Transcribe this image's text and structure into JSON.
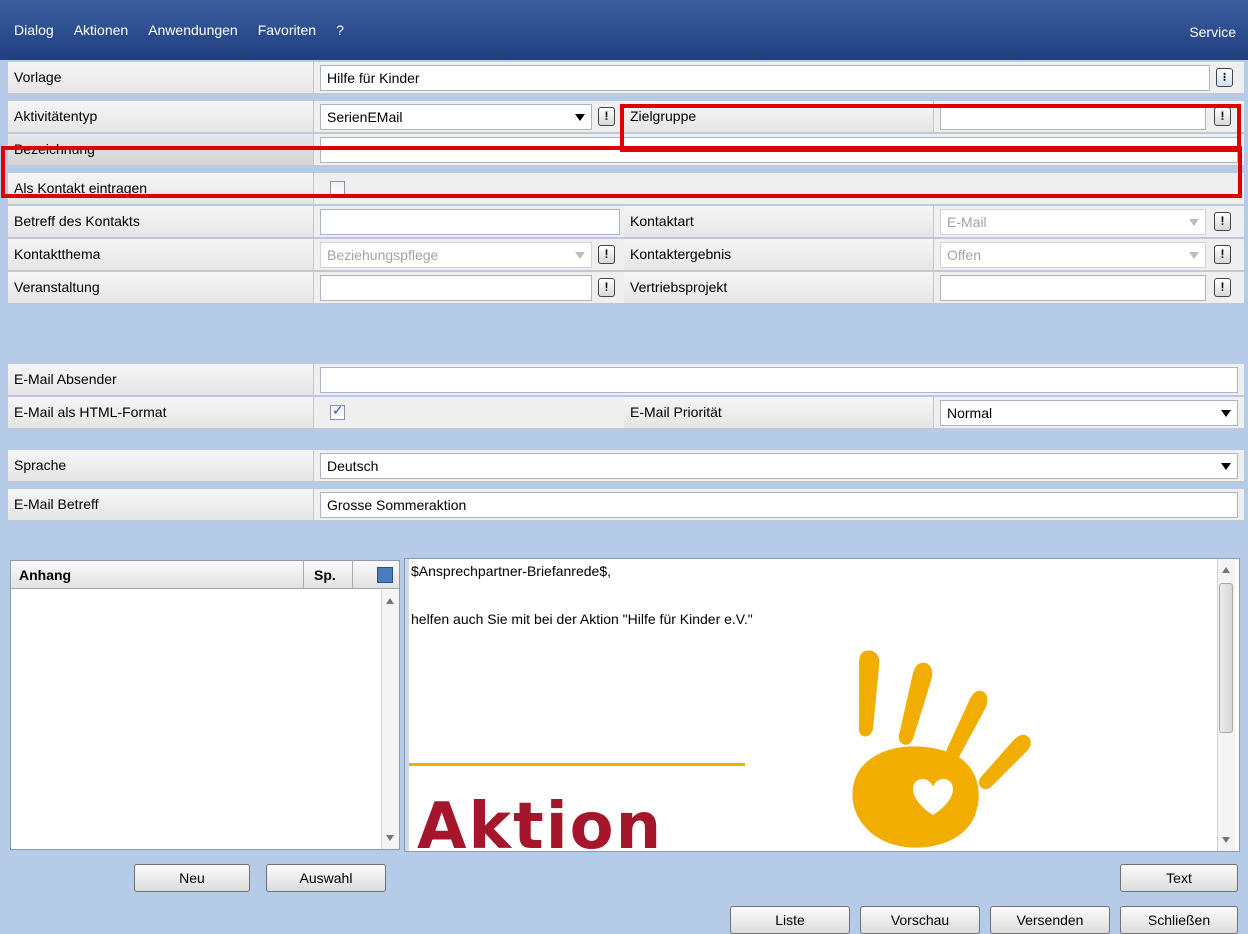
{
  "menu": {
    "items": [
      "Dialog",
      "Aktionen",
      "Anwendungen",
      "Favoriten",
      "?"
    ],
    "service": "Service"
  },
  "form": {
    "vorlage_label": "Vorlage",
    "vorlage_value": "Hilfe für Kinder",
    "aktivitaetentyp_label": "Aktivitätentyp",
    "aktivitaetentyp_value": "SerienEMail",
    "zielgruppe_label": "Zielgruppe",
    "zielgruppe_value": "",
    "bezeichnung_label": "Bezeichnung",
    "bezeichnung_value": "",
    "als_kontakt_label": "Als Kontakt eintragen",
    "als_kontakt_checked": false,
    "betreff_kontakt_label": "Betreff des Kontakts",
    "betreff_kontakt_value": "",
    "kontaktart_label": "Kontaktart",
    "kontaktart_value": "E-Mail",
    "kontaktthema_label": "Kontaktthema",
    "kontaktthema_value": "Beziehungspflege",
    "kontaktergebnis_label": "Kontaktergebnis",
    "kontaktergebnis_value": "Offen",
    "veranstaltung_label": "Veranstaltung",
    "veranstaltung_value": "",
    "vertriebsprojekt_label": "Vertriebsprojekt",
    "vertriebsprojekt_value": "",
    "email_absender_label": "E-Mail Absender",
    "email_absender_value": "",
    "html_format_label": "E-Mail als HTML-Format",
    "html_format_checked": true,
    "prioritaet_label": "E-Mail Priorität",
    "prioritaet_value": "Normal",
    "sprache_label": "Sprache",
    "sprache_value": "Deutsch",
    "email_betreff_label": "E-Mail Betreff",
    "email_betreff_value": "Grosse Sommeraktion"
  },
  "attachments": {
    "col_name": "Anhang",
    "col_sp": "Sp."
  },
  "editor": {
    "line1": "$Ansprechpartner-Briefanrede$,",
    "line2": "helfen auch Sie mit bei der Aktion \"Hilfe für Kinder e.V.\"",
    "logo_text": "Aktion"
  },
  "buttons": {
    "neu": "Neu",
    "auswahl": "Auswahl",
    "text": "Text",
    "liste": "Liste",
    "vorschau": "Vorschau",
    "versenden": "Versenden",
    "schliessen": "Schließen"
  },
  "colors": {
    "highlight": "#e00000",
    "logo_orange": "#f2ae00",
    "logo_red": "#a5152c"
  }
}
